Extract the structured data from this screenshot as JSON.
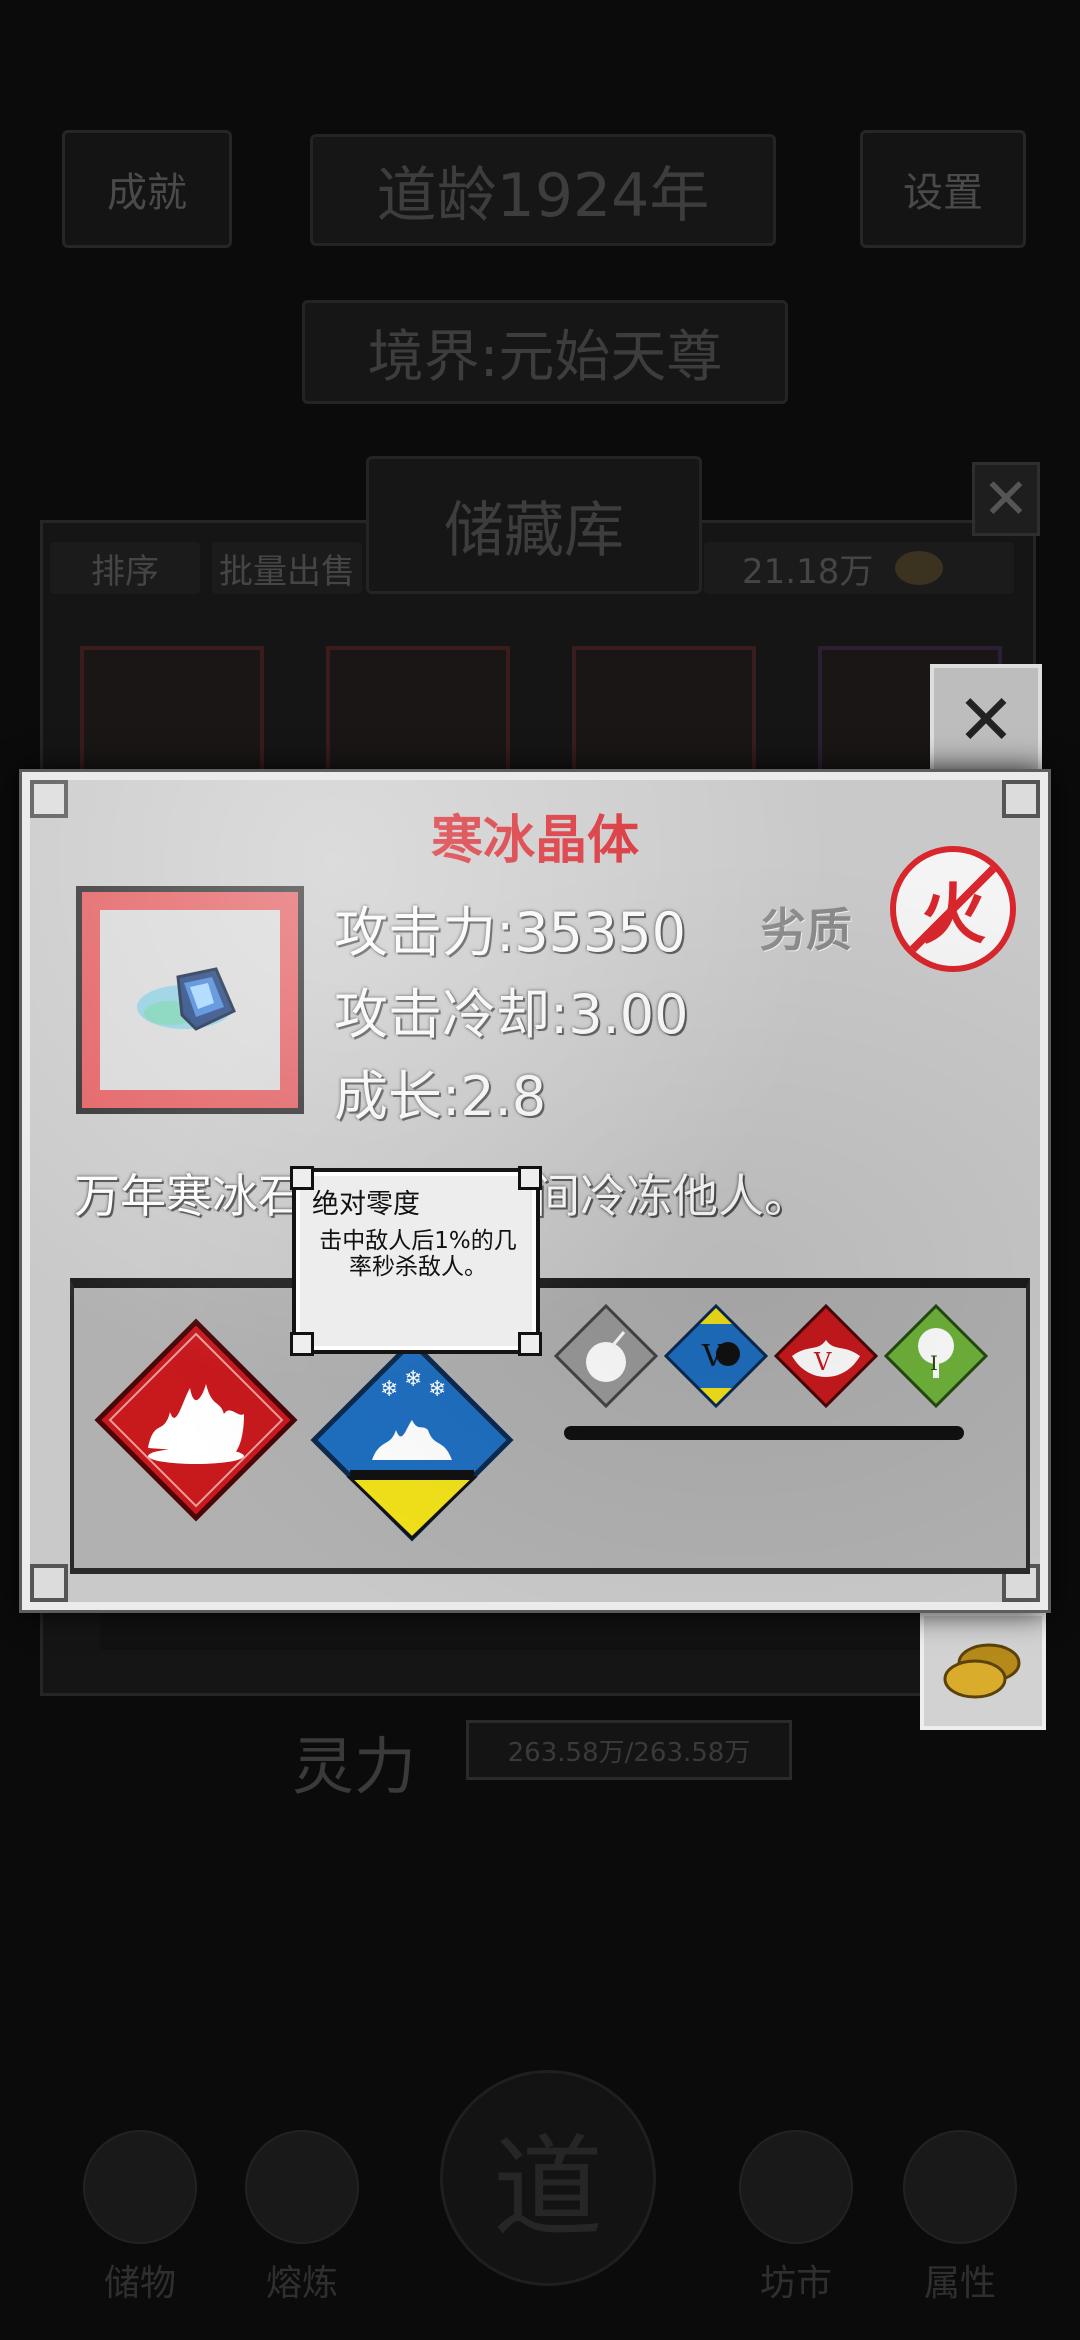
{
  "header": {
    "achievement_label": "成就",
    "era_label": "道龄1924年",
    "settings_label": "设置",
    "realm_label": "境界:元始天尊"
  },
  "storage": {
    "title": "储藏库",
    "sort_label": "排序",
    "bulk_sell_label": "批量出售",
    "currency_amount": "21.18万"
  },
  "spirit": {
    "label": "灵力",
    "value": "263.58万/263.58万"
  },
  "item_detail": {
    "name": "寒冰晶体",
    "attack_label": "攻击力:",
    "attack_value": "35350",
    "quality": "劣质",
    "element_badge": "火",
    "cooldown_label": "攻击冷却:",
    "cooldown_value": "3.00",
    "growth_label": "成长:",
    "growth_value": "2.8",
    "description": "万年寒冰石，能在一瞬间冷冻他人。"
  },
  "tooltip": {
    "title": "绝对零度",
    "body": "击中敌人后1%的几率秒杀敌人。"
  },
  "bottom_nav": {
    "items": [
      "储物",
      "熔炼",
      "道",
      "坊市",
      "属性"
    ]
  },
  "colors": {
    "title_red": "#d6242b",
    "frame_red": "#e25b5e",
    "ice_blue": "#1f6fc0",
    "fire_red": "#c8191d",
    "yellow": "#f2e21a",
    "green": "#6fb23a"
  }
}
